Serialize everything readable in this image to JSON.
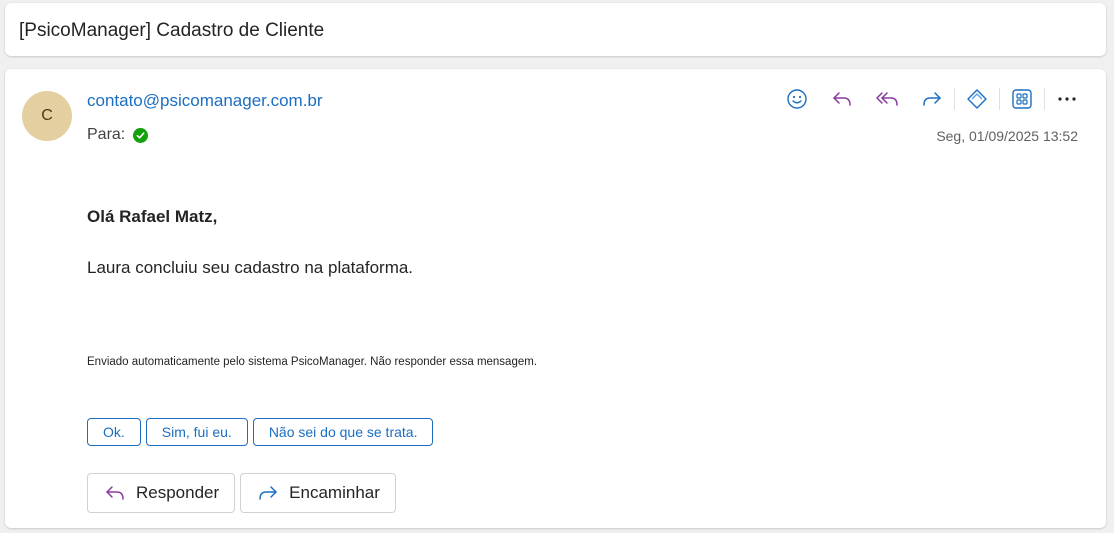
{
  "subject": "[PsicoManager] Cadastro de Cliente",
  "message": {
    "avatar_initial": "C",
    "sender": "contato@psicomanager.com.br",
    "to_label": "Para:",
    "date": "Seg, 01/09/2025 13:52",
    "greeting": "Olá Rafael Matz,",
    "body": "Laura concluiu seu cadastro na plataforma.",
    "footer_note": "Enviado automaticamente pelo sistema PsicoManager. Não responder essa mensagem."
  },
  "toolbar": {
    "icons": [
      "emoji-icon",
      "reply-icon",
      "reply-all-icon",
      "forward-icon",
      "loop-icon",
      "apps-icon",
      "more-icon"
    ],
    "colors": {
      "blue": "#1b6ec2",
      "purple": "#8a3a9f",
      "green": "#13a10e"
    }
  },
  "quick_replies": [
    "Ok.",
    "Sim, fui eu.",
    "Não sei do que se trata."
  ],
  "actions": {
    "reply_label": "Responder",
    "forward_label": "Encaminhar"
  }
}
